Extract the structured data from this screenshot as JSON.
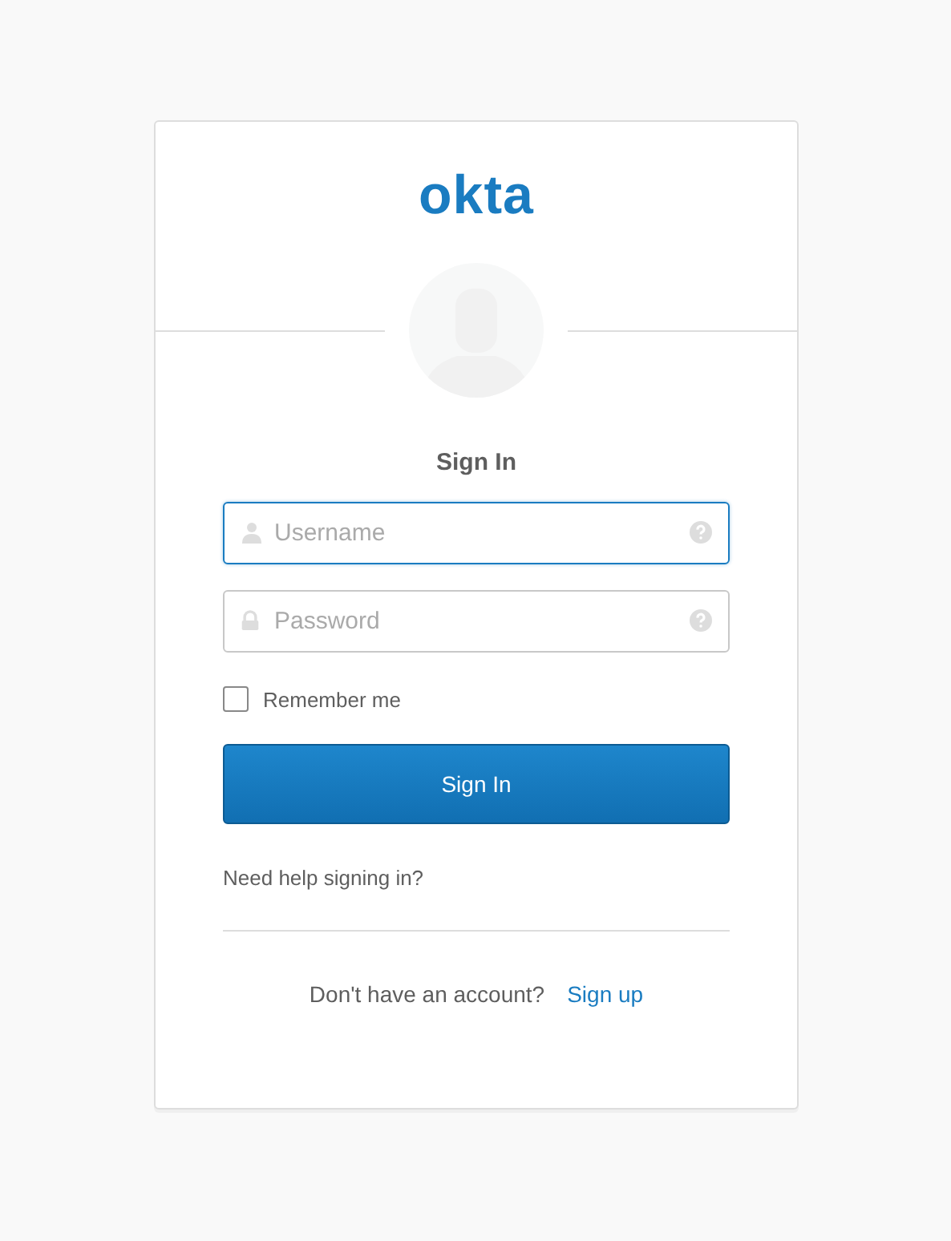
{
  "logo": "okta",
  "title": "Sign In",
  "fields": [
    {
      "kind": "user",
      "placeholder": "Username",
      "focused": true
    },
    {
      "kind": "lock",
      "placeholder": "Password",
      "focused": false
    }
  ],
  "remember": {
    "label": "Remember me",
    "checked": false
  },
  "submit": "Sign In",
  "help_link": "Need help signing in?",
  "footer": {
    "text": "Don't have an account?",
    "link": "Sign up"
  }
}
